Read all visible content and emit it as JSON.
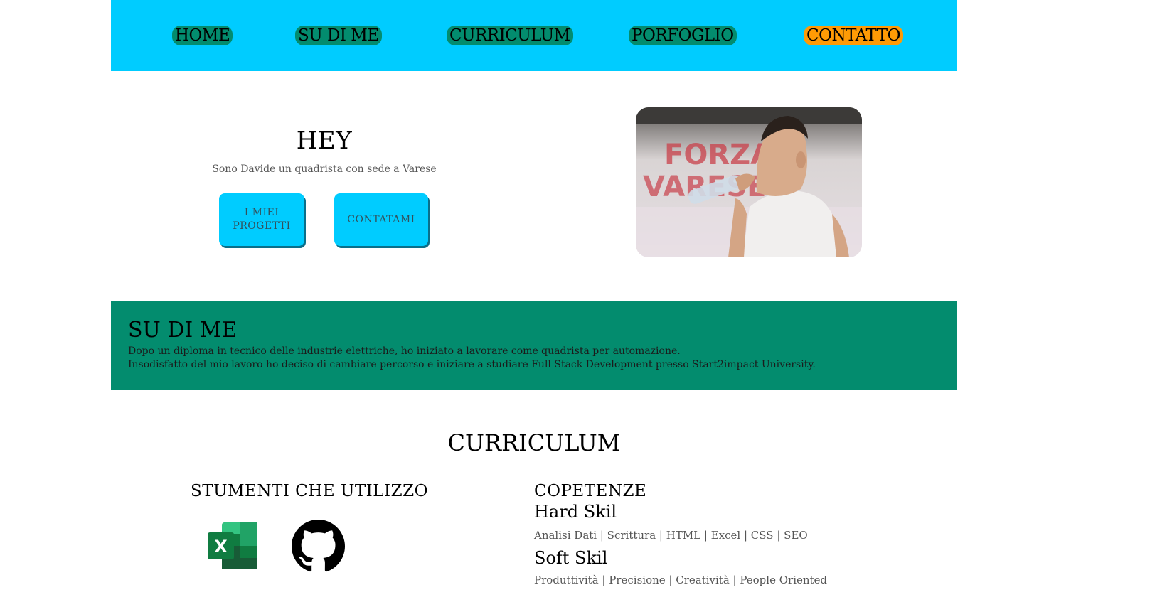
{
  "nav": {
    "items": [
      "HOME",
      "SU DI ME",
      "CURRICULUM",
      "PORFOGLIO",
      "CONTATTO"
    ],
    "active": "CONTATTO"
  },
  "hero": {
    "title": "HEY",
    "subtitle": "Sono Davide un quadrista con sede a Varese",
    "btn_projects": "I MIEI PROGETTI",
    "btn_contact": "CONTATAMI"
  },
  "about": {
    "title": "SU DI ME",
    "line1": "Dopo un diploma in tecnico delle industrie elettriche, ho iniziato a lavorare come quadrista per automazione.",
    "line2": "Insodisfatto del mio lavoro ho deciso di cambiare percorso e iniziare a studiare Full Stack Development presso Start2impact University."
  },
  "curriculum": {
    "title": "CURRICULUM",
    "tools_title": "STUMENTI CHE UTILIZZO",
    "tools": [
      "excel-icon",
      "github-icon"
    ],
    "competences_title": "COPETENZE",
    "hard_title": "Hard Skil",
    "hard_list": "Analisi Dati | Scrittura | HTML | Excel | CSS | SEO",
    "soft_title": "Soft Skil",
    "soft_list": "Produttività | Precisione | Creatività | People Oriented"
  },
  "colors": {
    "nav_bg": "#00ccff",
    "nav_pill": "#038c6e",
    "nav_active": "#ff9a05",
    "about_bg": "#038c6e",
    "button_bg": "#00ccff"
  }
}
